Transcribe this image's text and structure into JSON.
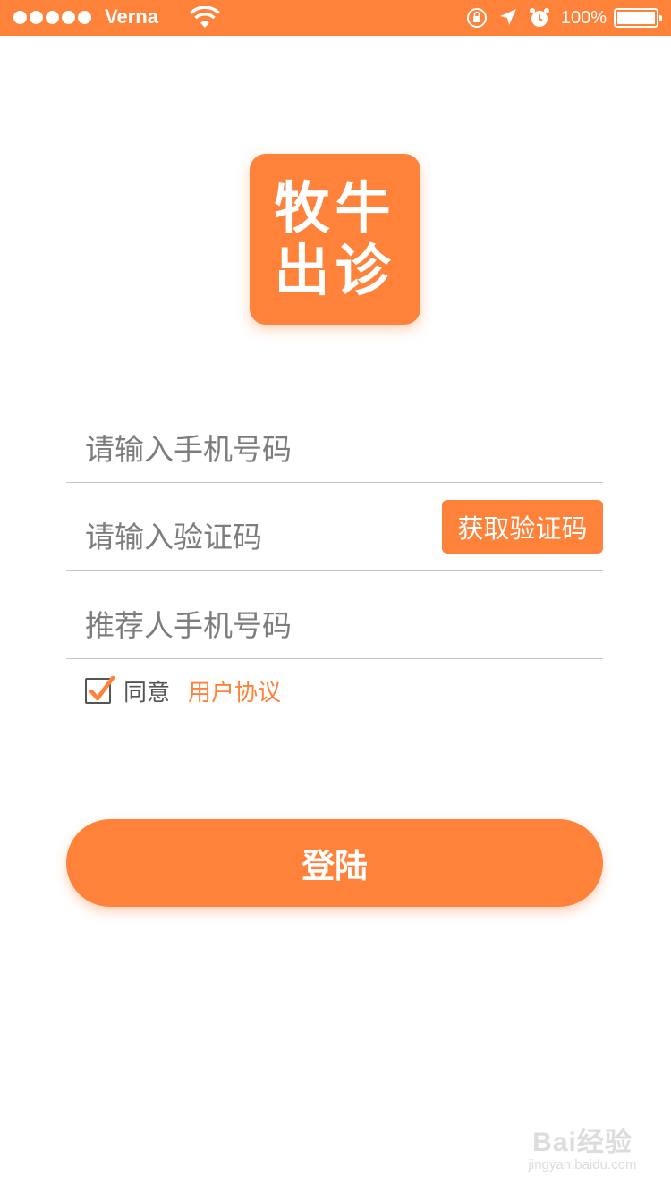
{
  "status_bar": {
    "carrier": "Verna",
    "battery": "100%"
  },
  "logo": {
    "line1": "牧牛",
    "line2": "出诊"
  },
  "form": {
    "phone_placeholder": "请输入手机号码",
    "code_placeholder": "请输入验证码",
    "get_code_label": "获取验证码",
    "referrer_placeholder": "推荐人手机号码"
  },
  "agreement": {
    "checked": true,
    "agree_label": "同意",
    "link_label": "用户协议"
  },
  "login_label": "登陆",
  "watermark": {
    "main": "Bai经验",
    "sub": "jingyan.baidu.com"
  },
  "colors": {
    "accent": "#ff823b",
    "divider": "#c6c6c6",
    "placeholder": "#7d7d7d"
  }
}
